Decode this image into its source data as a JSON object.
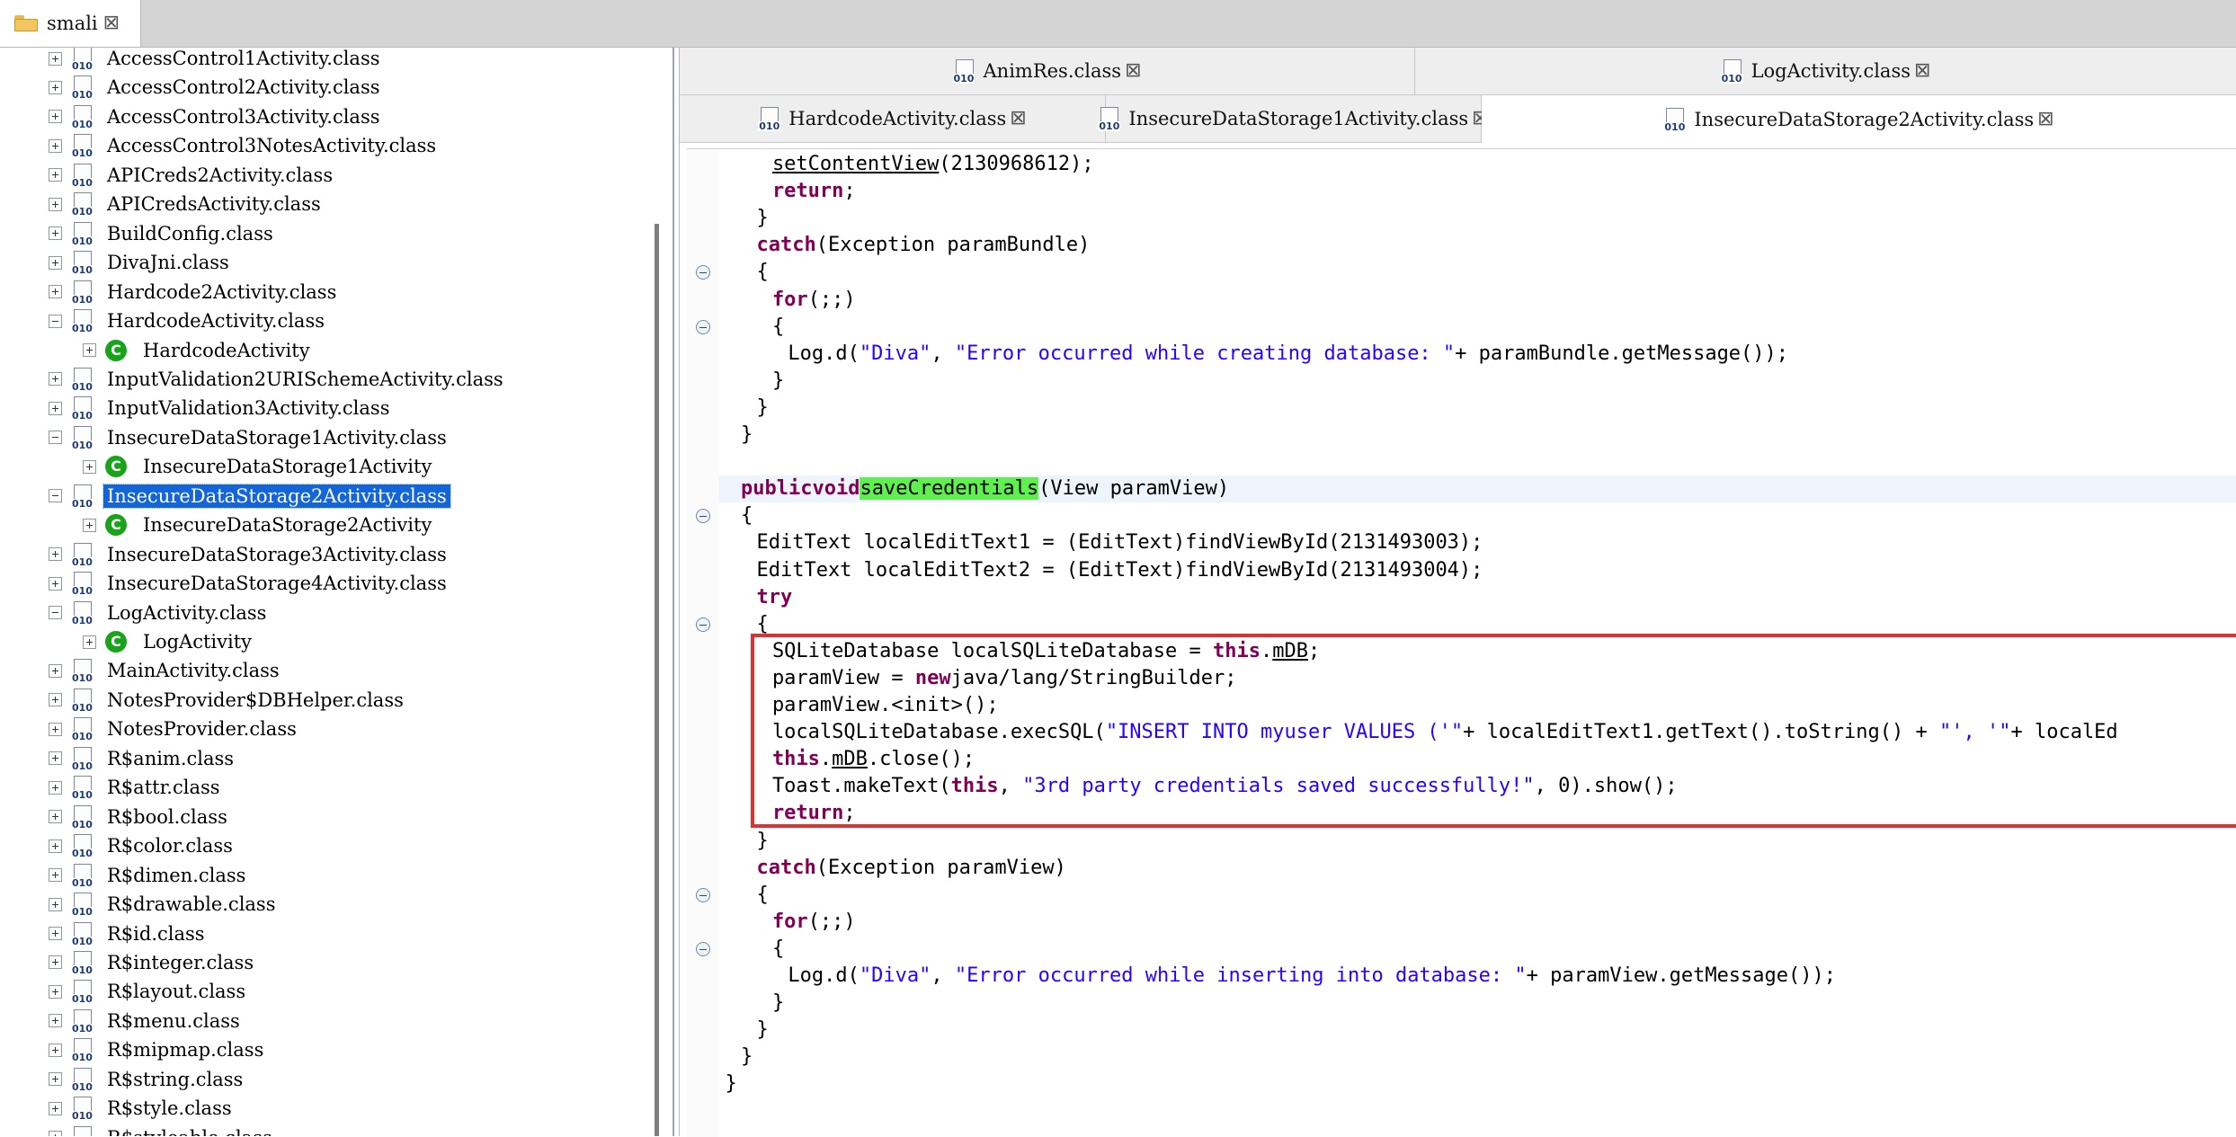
{
  "top_tab": {
    "label": "smali",
    "icon": "folder-icon",
    "close": "close-icon"
  },
  "tree": {
    "items": [
      {
        "label": "AccessControl1Activity.class",
        "kind": "file",
        "exp": "plus",
        "indent": 0
      },
      {
        "label": "AccessControl2Activity.class",
        "kind": "file",
        "exp": "plus",
        "indent": 0
      },
      {
        "label": "AccessControl3Activity.class",
        "kind": "file",
        "exp": "plus",
        "indent": 0
      },
      {
        "label": "AccessControl3NotesActivity.class",
        "kind": "file",
        "exp": "plus",
        "indent": 0
      },
      {
        "label": "APICreds2Activity.class",
        "kind": "file",
        "exp": "plus",
        "indent": 0
      },
      {
        "label": "APICredsActivity.class",
        "kind": "file",
        "exp": "plus",
        "indent": 0
      },
      {
        "label": "BuildConfig.class",
        "kind": "file",
        "exp": "plus",
        "indent": 0
      },
      {
        "label": "DivaJni.class",
        "kind": "file",
        "exp": "plus",
        "indent": 0
      },
      {
        "label": "Hardcode2Activity.class",
        "kind": "file",
        "exp": "plus",
        "indent": 0
      },
      {
        "label": "HardcodeActivity.class",
        "kind": "file",
        "exp": "minus",
        "indent": 0
      },
      {
        "label": "HardcodeActivity",
        "kind": "class",
        "exp": "plus",
        "indent": 1
      },
      {
        "label": "InputValidation2URISchemeActivity.class",
        "kind": "file",
        "exp": "plus",
        "indent": 0
      },
      {
        "label": "InputValidation3Activity.class",
        "kind": "file",
        "exp": "plus",
        "indent": 0
      },
      {
        "label": "InsecureDataStorage1Activity.class",
        "kind": "file",
        "exp": "minus",
        "indent": 0
      },
      {
        "label": "InsecureDataStorage1Activity",
        "kind": "class",
        "exp": "plus",
        "indent": 1
      },
      {
        "label": "InsecureDataStorage2Activity.class",
        "kind": "file",
        "exp": "minus",
        "indent": 0,
        "selected": true
      },
      {
        "label": "InsecureDataStorage2Activity",
        "kind": "class",
        "exp": "plus",
        "indent": 1
      },
      {
        "label": "InsecureDataStorage3Activity.class",
        "kind": "file",
        "exp": "plus",
        "indent": 0
      },
      {
        "label": "InsecureDataStorage4Activity.class",
        "kind": "file",
        "exp": "plus",
        "indent": 0
      },
      {
        "label": "LogActivity.class",
        "kind": "file",
        "exp": "minus",
        "indent": 0
      },
      {
        "label": "LogActivity",
        "kind": "class",
        "exp": "plus",
        "indent": 1
      },
      {
        "label": "MainActivity.class",
        "kind": "file",
        "exp": "plus",
        "indent": 0
      },
      {
        "label": "NotesProvider$DBHelper.class",
        "kind": "file",
        "exp": "plus",
        "indent": 0
      },
      {
        "label": "NotesProvider.class",
        "kind": "file",
        "exp": "plus",
        "indent": 0
      },
      {
        "label": "R$anim.class",
        "kind": "file",
        "exp": "plus",
        "indent": 0
      },
      {
        "label": "R$attr.class",
        "kind": "file",
        "exp": "plus",
        "indent": 0
      },
      {
        "label": "R$bool.class",
        "kind": "file",
        "exp": "plus",
        "indent": 0
      },
      {
        "label": "R$color.class",
        "kind": "file",
        "exp": "plus",
        "indent": 0
      },
      {
        "label": "R$dimen.class",
        "kind": "file",
        "exp": "plus",
        "indent": 0
      },
      {
        "label": "R$drawable.class",
        "kind": "file",
        "exp": "plus",
        "indent": 0
      },
      {
        "label": "R$id.class",
        "kind": "file",
        "exp": "plus",
        "indent": 0
      },
      {
        "label": "R$integer.class",
        "kind": "file",
        "exp": "plus",
        "indent": 0
      },
      {
        "label": "R$layout.class",
        "kind": "file",
        "exp": "plus",
        "indent": 0
      },
      {
        "label": "R$menu.class",
        "kind": "file",
        "exp": "plus",
        "indent": 0
      },
      {
        "label": "R$mipmap.class",
        "kind": "file",
        "exp": "plus",
        "indent": 0
      },
      {
        "label": "R$string.class",
        "kind": "file",
        "exp": "plus",
        "indent": 0
      },
      {
        "label": "R$style.class",
        "kind": "file",
        "exp": "plus",
        "indent": 0
      },
      {
        "label": "R$styleable.class",
        "kind": "file",
        "exp": "plus",
        "indent": 0
      }
    ]
  },
  "editor": {
    "tabs_row1": [
      {
        "label": "AnimRes.class",
        "active": false
      },
      {
        "label": "LogActivity.class",
        "active": false
      }
    ],
    "tabs_row2": [
      {
        "label": "HardcodeActivity.class",
        "active": false
      },
      {
        "label": "InsecureDataStorage1Activity.class",
        "active": false
      },
      {
        "label": "InsecureDataStorage2Activity.class",
        "active": true
      }
    ],
    "code_lines": [
      [
        [
          "",
          "    "
        ],
        [
          "mref",
          "setContentView"
        ],
        [
          "",
          "(2130968612);"
        ]
      ],
      [
        [
          "",
          "    "
        ],
        [
          "kw",
          "return"
        ],
        [
          "",
          ";"
        ]
      ],
      [
        [
          "",
          "  }"
        ]
      ],
      [
        [
          "",
          "  "
        ],
        [
          "kw",
          "catch"
        ],
        [
          "",
          " (Exception paramBundle)"
        ]
      ],
      [
        [
          "",
          "  {"
        ]
      ],
      [
        [
          "",
          "    "
        ],
        [
          "kw",
          "for"
        ],
        [
          "",
          " (;;)"
        ]
      ],
      [
        [
          "",
          "    {"
        ]
      ],
      [
        [
          "",
          "      Log.d("
        ],
        [
          "str",
          "\"Diva\""
        ],
        [
          "",
          ", "
        ],
        [
          "str",
          "\"Error occurred while creating database: \""
        ],
        [
          "",
          " + paramBundle.getMessage());"
        ]
      ],
      [
        [
          "",
          "    }"
        ]
      ],
      [
        [
          "",
          "  }"
        ]
      ],
      [
        [
          "",
          "}"
        ]
      ],
      [
        [
          "",
          ""
        ]
      ],
      [
        [
          "kw",
          "public"
        ],
        [
          "",
          " "
        ],
        [
          "kw",
          "void"
        ],
        [
          "",
          " "
        ],
        [
          "hlname",
          "saveCredentials"
        ],
        [
          "",
          "(View paramView)"
        ]
      ],
      [
        [
          "",
          "{"
        ]
      ],
      [
        [
          "",
          "  EditText localEditText1 = (EditText)findViewById(2131493003);"
        ]
      ],
      [
        [
          "",
          "  EditText localEditText2 = (EditText)findViewById(2131493004);"
        ]
      ],
      [
        [
          "",
          "  "
        ],
        [
          "kw",
          "try"
        ]
      ],
      [
        [
          "",
          "  {"
        ]
      ],
      [
        [
          "",
          "    SQLiteDatabase localSQLiteDatabase = "
        ],
        [
          "kw",
          "this"
        ],
        [
          "",
          "."
        ],
        [
          "fld",
          "mDB"
        ],
        [
          "",
          ";"
        ]
      ],
      [
        [
          "",
          "    paramView = "
        ],
        [
          "kw",
          "new"
        ],
        [
          "",
          " java/lang/StringBuilder;"
        ]
      ],
      [
        [
          "",
          "    paramView.<init>();"
        ]
      ],
      [
        [
          "",
          "    localSQLiteDatabase.execSQL("
        ],
        [
          "str",
          "\"INSERT INTO myuser VALUES ('\""
        ],
        [
          "",
          " + localEditText1.getText().toString() + "
        ],
        [
          "str",
          "\"', '\""
        ],
        [
          "",
          " + localEd"
        ]
      ],
      [
        [
          "",
          "    "
        ],
        [
          "kw",
          "this"
        ],
        [
          "",
          "."
        ],
        [
          "fld",
          "mDB"
        ],
        [
          "",
          ".close();"
        ]
      ],
      [
        [
          "",
          "    Toast.makeText("
        ],
        [
          "kw",
          "this"
        ],
        [
          "",
          ", "
        ],
        [
          "str",
          "\"3rd party credentials saved successfully!\""
        ],
        [
          "",
          ", 0).show();"
        ]
      ],
      [
        [
          "",
          "    "
        ],
        [
          "kw",
          "return"
        ],
        [
          "",
          ";"
        ]
      ],
      [
        [
          "",
          "  }"
        ]
      ],
      [
        [
          "",
          "  "
        ],
        [
          "kw",
          "catch"
        ],
        [
          "",
          " (Exception paramView)"
        ]
      ],
      [
        [
          "",
          "  {"
        ]
      ],
      [
        [
          "",
          "    "
        ],
        [
          "kw",
          "for"
        ],
        [
          "",
          " (;;)"
        ]
      ],
      [
        [
          "",
          "    {"
        ]
      ],
      [
        [
          "",
          "      Log.d("
        ],
        [
          "str",
          "\"Diva\""
        ],
        [
          "",
          ", "
        ],
        [
          "str",
          "\"Error occurred while inserting into database: \""
        ],
        [
          "",
          " + paramView.getMessage());"
        ]
      ],
      [
        [
          "",
          "    }"
        ]
      ],
      [
        [
          "",
          "  }"
        ]
      ],
      [
        [
          "",
          "}"
        ]
      ],
      [
        [
          "",
          "}"
        ]
      ]
    ],
    "code_indent": [
      4,
      4,
      2,
      2,
      2,
      4,
      4,
      6,
      4,
      2,
      0,
      0,
      0,
      0,
      2,
      2,
      2,
      2,
      4,
      4,
      4,
      4,
      4,
      4,
      4,
      2,
      2,
      2,
      4,
      4,
      6,
      4,
      2,
      0,
      -2
    ],
    "highlighted_line": 12,
    "fold_markers_at_lines": [
      4,
      6,
      13,
      17,
      27,
      29
    ]
  }
}
